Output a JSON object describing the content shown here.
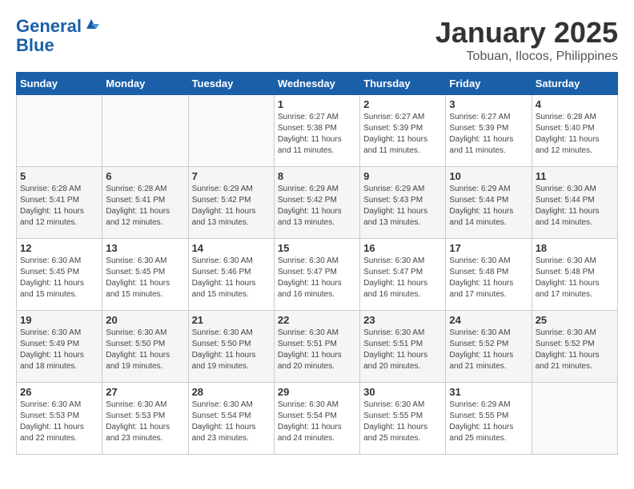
{
  "header": {
    "logo_line1": "General",
    "logo_line2": "Blue",
    "title": "January 2025",
    "subtitle": "Tobuan, Ilocos, Philippines"
  },
  "weekdays": [
    "Sunday",
    "Monday",
    "Tuesday",
    "Wednesday",
    "Thursday",
    "Friday",
    "Saturday"
  ],
  "weeks": [
    [
      {
        "day": "",
        "detail": ""
      },
      {
        "day": "",
        "detail": ""
      },
      {
        "day": "",
        "detail": ""
      },
      {
        "day": "1",
        "detail": "Sunrise: 6:27 AM\nSunset: 5:38 PM\nDaylight: 11 hours and 11 minutes."
      },
      {
        "day": "2",
        "detail": "Sunrise: 6:27 AM\nSunset: 5:39 PM\nDaylight: 11 hours and 11 minutes."
      },
      {
        "day": "3",
        "detail": "Sunrise: 6:27 AM\nSunset: 5:39 PM\nDaylight: 11 hours and 11 minutes."
      },
      {
        "day": "4",
        "detail": "Sunrise: 6:28 AM\nSunset: 5:40 PM\nDaylight: 11 hours and 12 minutes."
      }
    ],
    [
      {
        "day": "5",
        "detail": "Sunrise: 6:28 AM\nSunset: 5:41 PM\nDaylight: 11 hours and 12 minutes."
      },
      {
        "day": "6",
        "detail": "Sunrise: 6:28 AM\nSunset: 5:41 PM\nDaylight: 11 hours and 12 minutes."
      },
      {
        "day": "7",
        "detail": "Sunrise: 6:29 AM\nSunset: 5:42 PM\nDaylight: 11 hours and 13 minutes."
      },
      {
        "day": "8",
        "detail": "Sunrise: 6:29 AM\nSunset: 5:42 PM\nDaylight: 11 hours and 13 minutes."
      },
      {
        "day": "9",
        "detail": "Sunrise: 6:29 AM\nSunset: 5:43 PM\nDaylight: 11 hours and 13 minutes."
      },
      {
        "day": "10",
        "detail": "Sunrise: 6:29 AM\nSunset: 5:44 PM\nDaylight: 11 hours and 14 minutes."
      },
      {
        "day": "11",
        "detail": "Sunrise: 6:30 AM\nSunset: 5:44 PM\nDaylight: 11 hours and 14 minutes."
      }
    ],
    [
      {
        "day": "12",
        "detail": "Sunrise: 6:30 AM\nSunset: 5:45 PM\nDaylight: 11 hours and 15 minutes."
      },
      {
        "day": "13",
        "detail": "Sunrise: 6:30 AM\nSunset: 5:45 PM\nDaylight: 11 hours and 15 minutes."
      },
      {
        "day": "14",
        "detail": "Sunrise: 6:30 AM\nSunset: 5:46 PM\nDaylight: 11 hours and 15 minutes."
      },
      {
        "day": "15",
        "detail": "Sunrise: 6:30 AM\nSunset: 5:47 PM\nDaylight: 11 hours and 16 minutes."
      },
      {
        "day": "16",
        "detail": "Sunrise: 6:30 AM\nSunset: 5:47 PM\nDaylight: 11 hours and 16 minutes."
      },
      {
        "day": "17",
        "detail": "Sunrise: 6:30 AM\nSunset: 5:48 PM\nDaylight: 11 hours and 17 minutes."
      },
      {
        "day": "18",
        "detail": "Sunrise: 6:30 AM\nSunset: 5:48 PM\nDaylight: 11 hours and 17 minutes."
      }
    ],
    [
      {
        "day": "19",
        "detail": "Sunrise: 6:30 AM\nSunset: 5:49 PM\nDaylight: 11 hours and 18 minutes."
      },
      {
        "day": "20",
        "detail": "Sunrise: 6:30 AM\nSunset: 5:50 PM\nDaylight: 11 hours and 19 minutes."
      },
      {
        "day": "21",
        "detail": "Sunrise: 6:30 AM\nSunset: 5:50 PM\nDaylight: 11 hours and 19 minutes."
      },
      {
        "day": "22",
        "detail": "Sunrise: 6:30 AM\nSunset: 5:51 PM\nDaylight: 11 hours and 20 minutes."
      },
      {
        "day": "23",
        "detail": "Sunrise: 6:30 AM\nSunset: 5:51 PM\nDaylight: 11 hours and 20 minutes."
      },
      {
        "day": "24",
        "detail": "Sunrise: 6:30 AM\nSunset: 5:52 PM\nDaylight: 11 hours and 21 minutes."
      },
      {
        "day": "25",
        "detail": "Sunrise: 6:30 AM\nSunset: 5:52 PM\nDaylight: 11 hours and 21 minutes."
      }
    ],
    [
      {
        "day": "26",
        "detail": "Sunrise: 6:30 AM\nSunset: 5:53 PM\nDaylight: 11 hours and 22 minutes."
      },
      {
        "day": "27",
        "detail": "Sunrise: 6:30 AM\nSunset: 5:53 PM\nDaylight: 11 hours and 23 minutes."
      },
      {
        "day": "28",
        "detail": "Sunrise: 6:30 AM\nSunset: 5:54 PM\nDaylight: 11 hours and 23 minutes."
      },
      {
        "day": "29",
        "detail": "Sunrise: 6:30 AM\nSunset: 5:54 PM\nDaylight: 11 hours and 24 minutes."
      },
      {
        "day": "30",
        "detail": "Sunrise: 6:30 AM\nSunset: 5:55 PM\nDaylight: 11 hours and 25 minutes."
      },
      {
        "day": "31",
        "detail": "Sunrise: 6:29 AM\nSunset: 5:55 PM\nDaylight: 11 hours and 25 minutes."
      },
      {
        "day": "",
        "detail": ""
      }
    ]
  ]
}
